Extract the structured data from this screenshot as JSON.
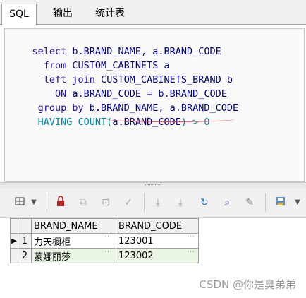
{
  "tabs": [
    {
      "label": "SQL",
      "active": true
    },
    {
      "label": "输出",
      "active": false
    },
    {
      "label": "统计表",
      "active": false
    }
  ],
  "editor": {
    "lines": [
      {
        "parts": [
          {
            "t": "select ",
            "c": "kw"
          },
          {
            "t": "b.BRAND_NAME, a.BRAND_CODE",
            "c": "id"
          }
        ]
      },
      {
        "parts": [
          {
            "t": "  from ",
            "c": "kw"
          },
          {
            "t": "CUSTOM_CABINETS a",
            "c": "id"
          }
        ]
      },
      {
        "parts": [
          {
            "t": "  left join ",
            "c": "kw"
          },
          {
            "t": "CUSTOM_CABINETS_BRAND b",
            "c": "id"
          }
        ]
      },
      {
        "parts": [
          {
            "t": "    ON ",
            "c": "kw"
          },
          {
            "t": "a.BRAND_CODE = b.BRAND_CODE",
            "c": "id"
          }
        ]
      },
      {
        "parts": [
          {
            "t": " group by ",
            "c": "kw"
          },
          {
            "t": "b.BRAND_NAME, a.BRAND_CODE",
            "c": "id"
          }
        ]
      },
      {
        "parts": [
          {
            "t": " HAVING COUNT(",
            "c": "kw2"
          },
          {
            "t": "a.BRAND_CODE",
            "c": "id"
          },
          {
            "t": ") > 0",
            "c": "kw2"
          }
        ]
      }
    ]
  },
  "toolbar": {
    "icons": [
      "grid-options-icon",
      "dropdown-arrow-icon",
      "lock-icon",
      "insert-record-icon",
      "delete-record-icon",
      "post-edit-icon",
      "move-first-icon",
      "move-last-icon",
      "refresh-icon",
      "find-icon",
      "clear-icon",
      "export-icon",
      "more-icon"
    ]
  },
  "grid": {
    "columns": [
      "BRAND_NAME",
      "BRAND_CODE"
    ],
    "rows": [
      {
        "num": "1",
        "values": [
          "力天橱柜",
          "123001"
        ],
        "selected": true
      },
      {
        "num": "2",
        "values": [
          "蒙娜丽莎",
          "123002"
        ],
        "selected": false
      }
    ]
  },
  "watermark": "CSDN @你是臭弟弟",
  "colors": {
    "keyword": "#1a0dab",
    "keyword_alt": "#00879c",
    "identifier": "#000080",
    "highlight_underline": "#e04a4a",
    "alt_row": "#eaf5e4"
  }
}
